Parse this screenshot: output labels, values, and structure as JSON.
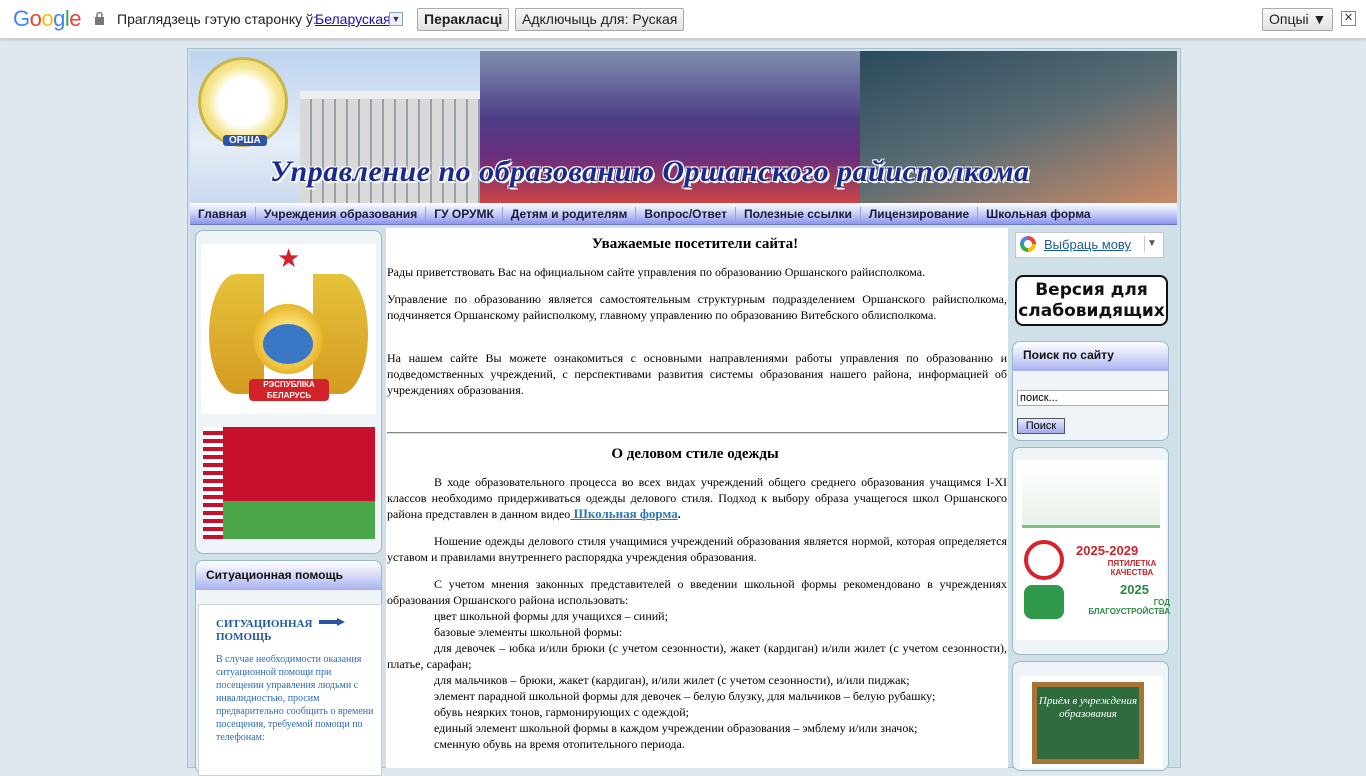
{
  "translate_bar": {
    "logo": "Google",
    "prompt": "Праглядзець гэтую старонку ў:",
    "language": "Беларуская",
    "translate_button": "Перакласці",
    "disable_button": "Адключыць для: Руская",
    "options_button": "Опцыі ▼",
    "close": "✕"
  },
  "header": {
    "emblem_text": "ОРША",
    "title": "Управление по образованию Оршанского райисполкома"
  },
  "nav": [
    "Главная",
    "Учреждения образования",
    "ГУ ОРУМК",
    "Детям и родителям",
    "Вопрос/Ответ",
    "Полезные ссылки",
    "Лицензирование",
    "Школьная форма"
  ],
  "left": {
    "coat_ribbon": "РЭСПУБЛІКА БЕЛАРУСЬ",
    "situational_title": "Ситуационная помощь",
    "situational_head": "СИТУАЦИОННАЯ ПОМОЩЬ",
    "situational_body": "В случае необходимости оказания ситуационной помощи при посещении управления людьми с инвалидностью, просим предварительно сообщить о времени посещения, требуемой помощи по телефонам:"
  },
  "main": {
    "welcome_title": "Уважаемые посетители сайта!",
    "p1": "Рады приветствовать Вас на официальном сайте управления по образованию Оршанского райисполкома.",
    "p2": "Управление по образованию является самостоятельным структурным подразделением Оршанского райисполкома, подчиняется Оршанскому райисполкому, главному управлению по образованию Витебского облисполкома.",
    "p3": "На нашем сайте Вы можете ознакомиться с основными направлениями работы управления по образованию и подведомственных учреждений, с перспективами развития системы образования нашего района, информацией об учреждениях образования.",
    "style_title": "О деловом стиле одежды",
    "p4_text": "В ходе образовательного процесса во всех видах учреждений общего среднего образования учащимся I-XI классов необходимо придерживаться одежды делового стиля. Подход к выбору образа учащегося школ Оршанского района представлен в данном видео",
    "p4_link": " Школьная форма",
    "p4_end": ".",
    "p5": "Ношение одежды делового стиля учащимися учреждений образования является нормой, которая определяется уставом и правилами внутреннего распорядка учреждения образования.",
    "p6": "С учетом мнения законных представителей о введении школьной формы рекомендовано в учреждениях образования Оршанского района использовать:",
    "list": [
      "цвет школьной формы для учащихся – синий;",
      "базовые элементы школьной формы:",
      "для девочек – юбка и/или брюки (с учетом сезонности), жакет (кардиган) и/или жилет (с учетом сезонности), платье, сарафан;",
      "для мальчиков – брюки, жакет (кардиган), и/или жилет (с учетом сезонности), и/или пиджак;",
      "элемент парадной школьной формы для девочек – белую блузку, для мальчиков – белую рубашку;",
      "обувь неярких тонов, гармонирующих с одеждой;",
      "единый элемент школьной формы в каждом учреждении образования – эмблему и/или значок;",
      "сменную обувь на время отопительного периода."
    ]
  },
  "right": {
    "translate_widget": "Выбраць мову",
    "vision_button": "Версия для слабовидящих",
    "search_title": "Поиск по сайту",
    "search_placeholder": "поиск...",
    "search_button": "Поиск",
    "quality_year1": "2025-2029",
    "quality_text1": "ПЯТИЛЕТКА КАЧЕСТВА",
    "quality_year2": "2025",
    "quality_text2": "ГОД БЛАГОУСТРОЙСТВА",
    "board_text": "Приём в учреждения образования"
  }
}
